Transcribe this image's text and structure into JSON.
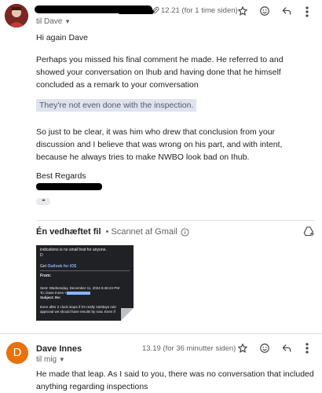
{
  "msg1": {
    "to_label": "til Dave",
    "time": "12.21 (for 1 time siden)",
    "greeting": "Hi again Dave",
    "para1": "Perhaps you missed his final comment he made. He referred to and showed your conversation on Ihub and having done that he himself concluded as a remark to your comversation",
    "quote": "They're not even done with the inspection.",
    "para2": "So just to be clear, it was him who drew that conclusion from your discussion and I believe that was wrong on his part, and with intent, because he always tries to make NWBO look bad on Ihub.",
    "signoff": "Best Regards",
    "ellipsis": "•••"
  },
  "attachments": {
    "title": "Én vedhæftet fil",
    "scanned": "• Scannet af Gmail",
    "thumb": {
      "line1": "indications is no small feat for anyone.",
      "line2": "D",
      "get_prefix": "Get ",
      "get_link": "Outlook for iOS",
      "from": "From:",
      "sent": "Sent: Wednesday, December 11, 2024 6:46:24 PM",
      "to": "To: Dave Innes <",
      "subject": "Subject: Re:",
      "body1": "Even after 2 clock stops if it's really 150days rule",
      "body2": "approval we should have results by now. Even if"
    }
  },
  "msg2": {
    "avatar_letter": "D",
    "sender": "Dave Innes",
    "time": "13.19 (for 36 minutter siden)",
    "to_label": "til mig",
    "body": "He made that leap.  As I said to you,  there was no conversation that included anything regarding inspections"
  },
  "colors": {
    "avatar_orange": "#e8710a",
    "quote_bg": "#dfe3ee",
    "thumb_bg": "#202124",
    "link": "#8ab4f8"
  }
}
